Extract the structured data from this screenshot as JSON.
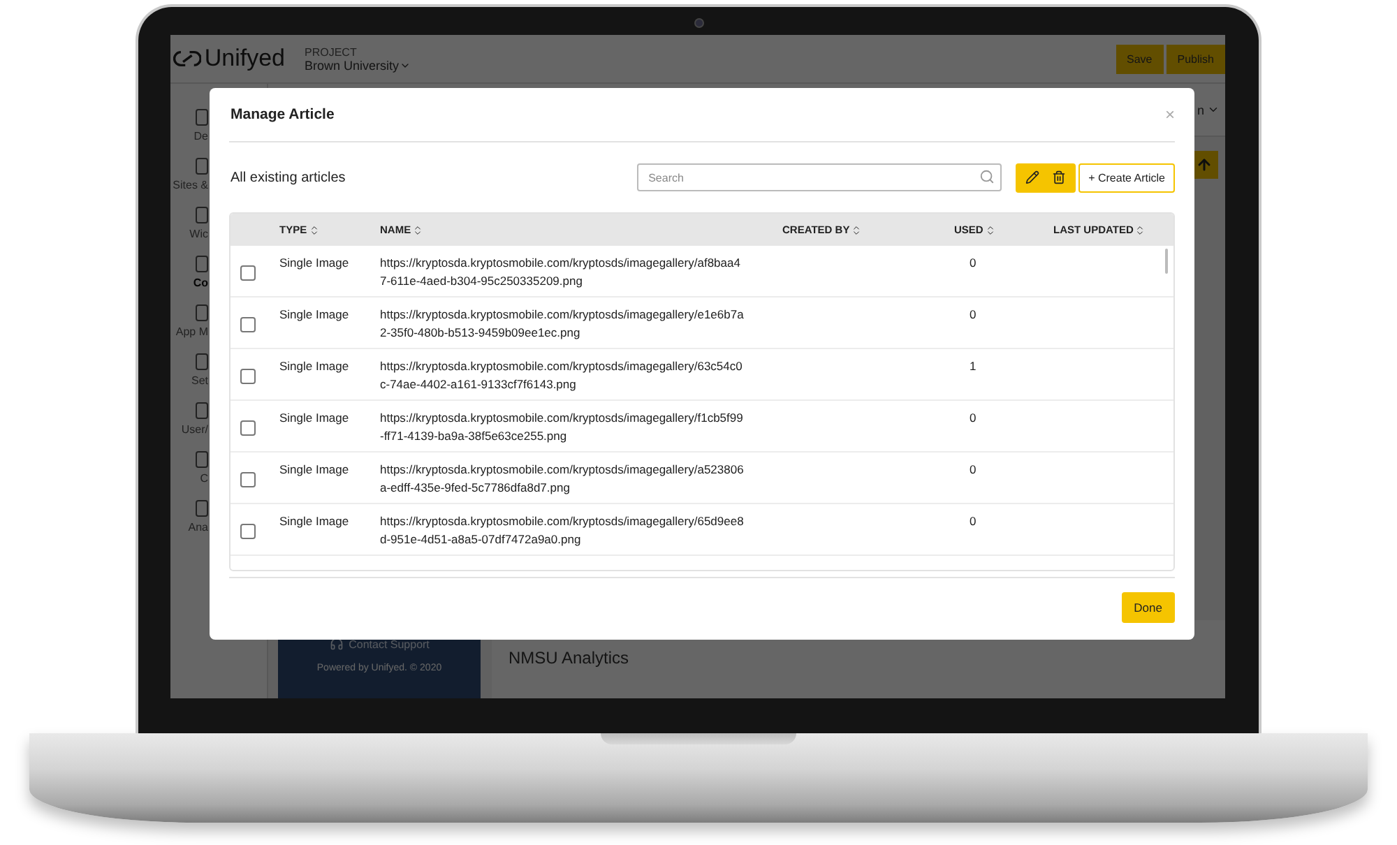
{
  "app": {
    "logo": "Unifyed",
    "project_label": "PROJECT",
    "project": "Brown University",
    "save": "Save",
    "publish": "Publish",
    "header_fragment": "n",
    "sidebar": [
      {
        "label": "De",
        "selected": false
      },
      {
        "label": "Sites &",
        "selected": false
      },
      {
        "label": "Wic",
        "selected": false
      },
      {
        "label": "Co",
        "selected": true
      },
      {
        "label": "App M",
        "selected": false
      },
      {
        "label": "Set",
        "selected": false
      },
      {
        "label": "User/",
        "selected": false
      },
      {
        "label": "C",
        "selected": false
      },
      {
        "label": "Ana",
        "selected": false
      }
    ],
    "support": "Contact Support",
    "powered": "Powered by Unifyed. © 2020",
    "section_title": "NMSU Analytics"
  },
  "modal": {
    "title": "Manage Article",
    "close": "×",
    "subtitle": "All existing articles",
    "search": {
      "placeholder": "Search"
    },
    "create": "+ Create Article",
    "columns": [
      {
        "label": "TYPE"
      },
      {
        "label": "NAME"
      },
      {
        "label": "CREATED BY"
      },
      {
        "label": "USED"
      },
      {
        "label": "LAST UPDATED"
      }
    ],
    "rows": [
      {
        "checked": false,
        "type": "Single Image",
        "name": "https://kryptosda.kryptosmobile.com/kryptosds/imagegallery/af8baa47-611e-4aed-b304-95c250335209.png",
        "used": "0"
      },
      {
        "checked": false,
        "type": "Single Image",
        "name": "https://kryptosda.kryptosmobile.com/kryptosds/imagegallery/e1e6b7a2-35f0-480b-b513-9459b09ee1ec.png",
        "used": "0"
      },
      {
        "checked": false,
        "type": "Single Image",
        "name": "https://kryptosda.kryptosmobile.com/kryptosds/imagegallery/63c54c0c-74ae-4402-a161-9133cf7f6143.png",
        "used": "1"
      },
      {
        "checked": false,
        "type": "Single Image",
        "name": "https://kryptosda.kryptosmobile.com/kryptosds/imagegallery/f1cb5f99-ff71-4139-ba9a-38f5e63ce255.png",
        "used": "0"
      },
      {
        "checked": false,
        "type": "Single Image",
        "name": "https://kryptosda.kryptosmobile.com/kryptosds/imagegallery/a523806a-edff-435e-9fed-5c7786dfa8d7.png",
        "used": "0"
      },
      {
        "checked": false,
        "type": "Single Image",
        "name": "https://kryptosda.kryptosmobile.com/kryptosds/imagegallery/65d9ee8d-951e-4d51-a8a5-07df7472a9a0.png",
        "used": "0"
      }
    ],
    "done": "Done"
  }
}
